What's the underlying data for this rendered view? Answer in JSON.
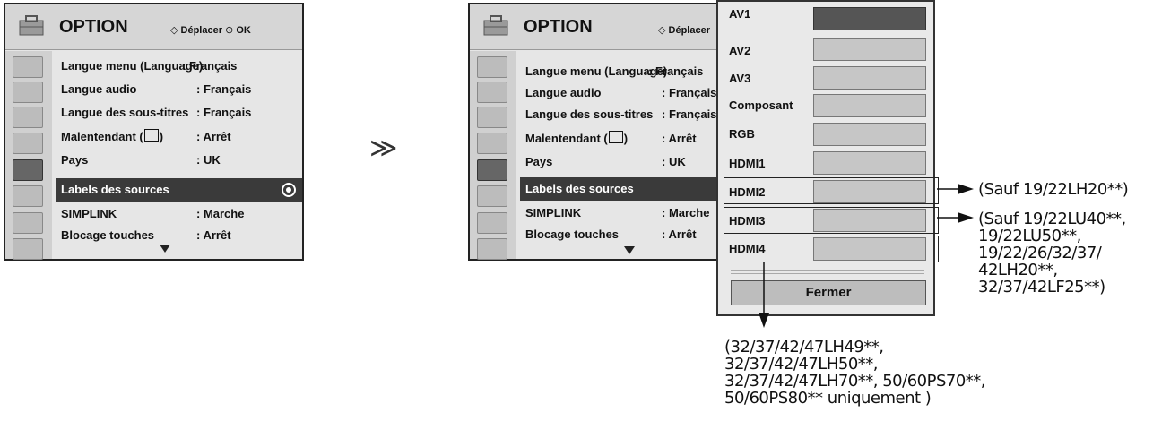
{
  "menu": {
    "title": "OPTION",
    "nav_hint_move": "Déplacer",
    "nav_hint_ok": "OK",
    "rows": [
      {
        "label": "Langue menu (Language)",
        "value": ": Français"
      },
      {
        "label": "Langue audio",
        "value": ": Français"
      },
      {
        "label": "Langue des sous-titres",
        "value": ": Français"
      },
      {
        "label": "Malentendant (",
        "label_tail": ")",
        "value": ": Arrêt"
      },
      {
        "label": "Pays",
        "value": ": UK"
      },
      {
        "label": "Labels des sources",
        "value": ""
      },
      {
        "label": "SIMPLINK",
        "value": ": Marche"
      },
      {
        "label": "Blocage touches",
        "value": ": Arrêt"
      }
    ],
    "icons": [
      "satellite-icon",
      "screen-icon",
      "speaker-icon",
      "clock-icon",
      "option-icon",
      "lock-icon",
      "bluetooth-icon",
      "movie-icon"
    ]
  },
  "step_arrow": "≫",
  "source_popup": {
    "items": [
      "AV1",
      "AV2",
      "AV3",
      "Composant",
      "RGB",
      "HDMI1",
      "HDMI2",
      "HDMI3",
      "HDMI4"
    ],
    "close_label": "Fermer"
  },
  "notes": {
    "hdmi2": "(Sauf 19/22LH20**)",
    "hdmi3_lines": [
      "(Sauf 19/22LU40**,",
      "19/22LU50**,",
      "19/22/26/32/37/",
      "42LH20**,",
      "32/37/42LF25**)"
    ],
    "hdmi4_lines": [
      "(32/37/42/47LH49**,",
      "32/37/42/47LH50**,",
      "32/37/42/47LH70**, 50/60PS70**,",
      "50/60PS80** uniquement )"
    ]
  }
}
